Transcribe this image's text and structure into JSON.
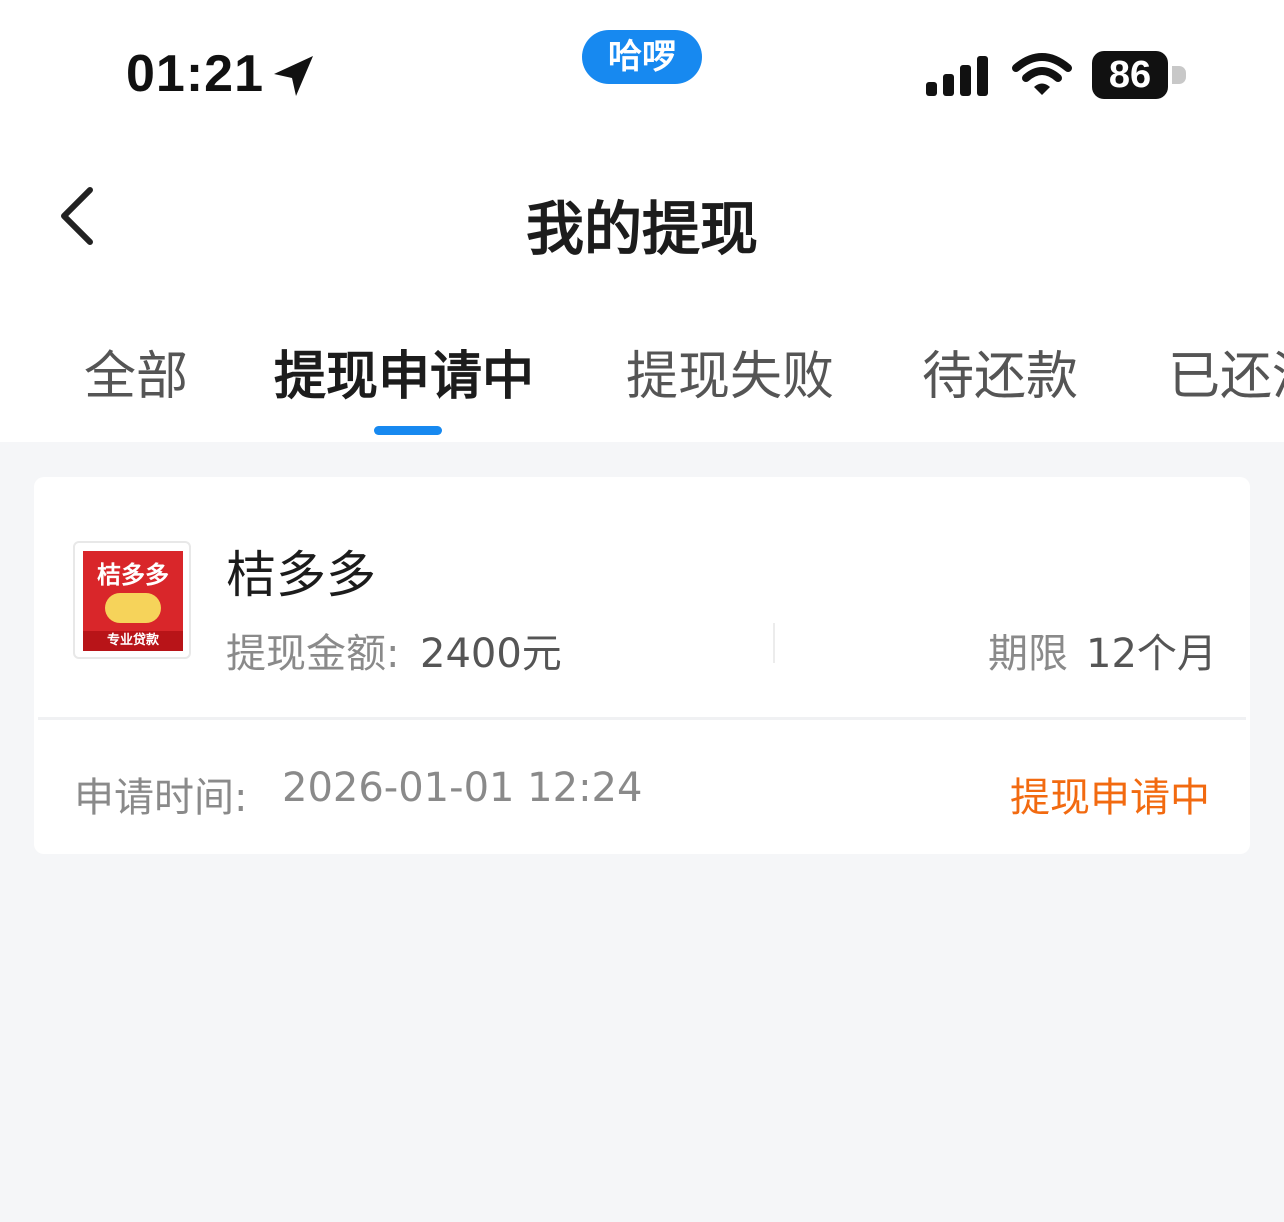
{
  "status_bar": {
    "time": "01:21",
    "pill_label": "哈啰",
    "battery": "86"
  },
  "nav": {
    "title": "我的提现"
  },
  "tabs": [
    {
      "label": "全部"
    },
    {
      "label": "提现申请中",
      "active": true
    },
    {
      "label": "提现失败"
    },
    {
      "label": "待还款"
    },
    {
      "label": "已还清"
    }
  ],
  "card": {
    "logo": {
      "icon": "juduoduo-logo",
      "top_text": "桔多多",
      "bottom_text": "专业贷款"
    },
    "product_name": "桔多多",
    "amount_label": "提现金额:",
    "amount_value": "2400元",
    "term_label": "期限",
    "term_value": "12个月",
    "apply_time_label": "申请时间:",
    "apply_time_value": "2026-01-01 12:24",
    "status": "提现申请中"
  },
  "colors": {
    "accent": "#1789f0",
    "status_orange": "#f26a10"
  }
}
